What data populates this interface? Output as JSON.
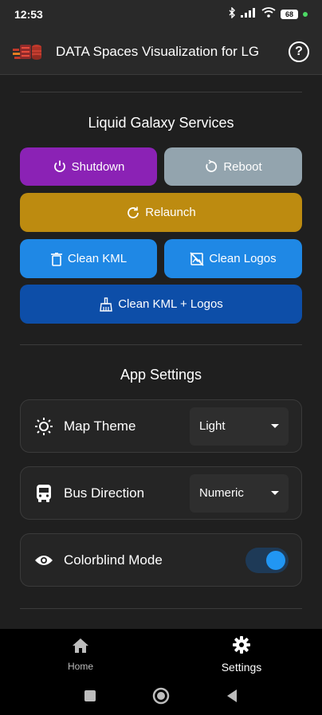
{
  "status_bar": {
    "time": "12:53",
    "battery": "68"
  },
  "app_bar": {
    "title": "DATA Spaces Visualization for LG",
    "help_icon": "help-circle-icon"
  },
  "services": {
    "title": "Liquid Galaxy Services",
    "shutdown": "Shutdown",
    "reboot": "Reboot",
    "relaunch": "Relaunch",
    "clean_kml": "Clean KML",
    "clean_logos": "Clean Logos",
    "clean_all": "Clean KML + Logos"
  },
  "settings": {
    "title": "App Settings",
    "map_theme": {
      "label": "Map Theme",
      "value": "Light"
    },
    "bus_direction": {
      "label": "Bus Direction",
      "value": "Numeric"
    },
    "colorblind": {
      "label": "Colorblind Mode",
      "enabled": true
    }
  },
  "bottom_nav": {
    "items": [
      {
        "label": "Home",
        "icon": "home-icon",
        "active": false
      },
      {
        "label": "Settings",
        "icon": "gear-icon",
        "active": true
      }
    ]
  },
  "colors": {
    "shutdown": "#8b22b5",
    "reboot": "#93a4ae",
    "relaunch": "#bd8b10",
    "clean": "#1f88e5",
    "clean_all": "#0d4ea8",
    "accent": "#2196f3"
  }
}
